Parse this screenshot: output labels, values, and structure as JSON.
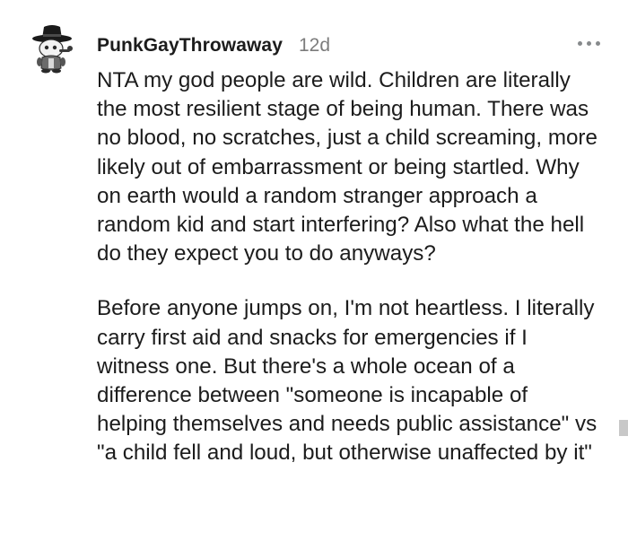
{
  "comment": {
    "author": "PunkGayThrowaway",
    "age": "12d",
    "avatar_icon": "snoo-avatar-icon",
    "more_icon": "more-options-icon",
    "paragraphs": [
      "NTA my god people are wild. Children are literally the most resilient stage of being human. There was no blood, no scratches, just a child screaming, more likely out of embarrassment or being startled. Why on earth would a random stranger approach a random kid and start interfering? Also what the hell do they expect you to do anyways?",
      "Before anyone jumps on, I'm not heartless. I literally carry first aid and snacks for emergencies if I witness one. But there's a whole ocean of a difference between \"someone is incapable of helping themselves and needs public assistance\" vs \"a child fell and loud, but otherwise unaffected by it\""
    ]
  },
  "colors": {
    "text": "#1c1c1c",
    "meta": "#7c7c7c",
    "dots": "#878a8c"
  }
}
